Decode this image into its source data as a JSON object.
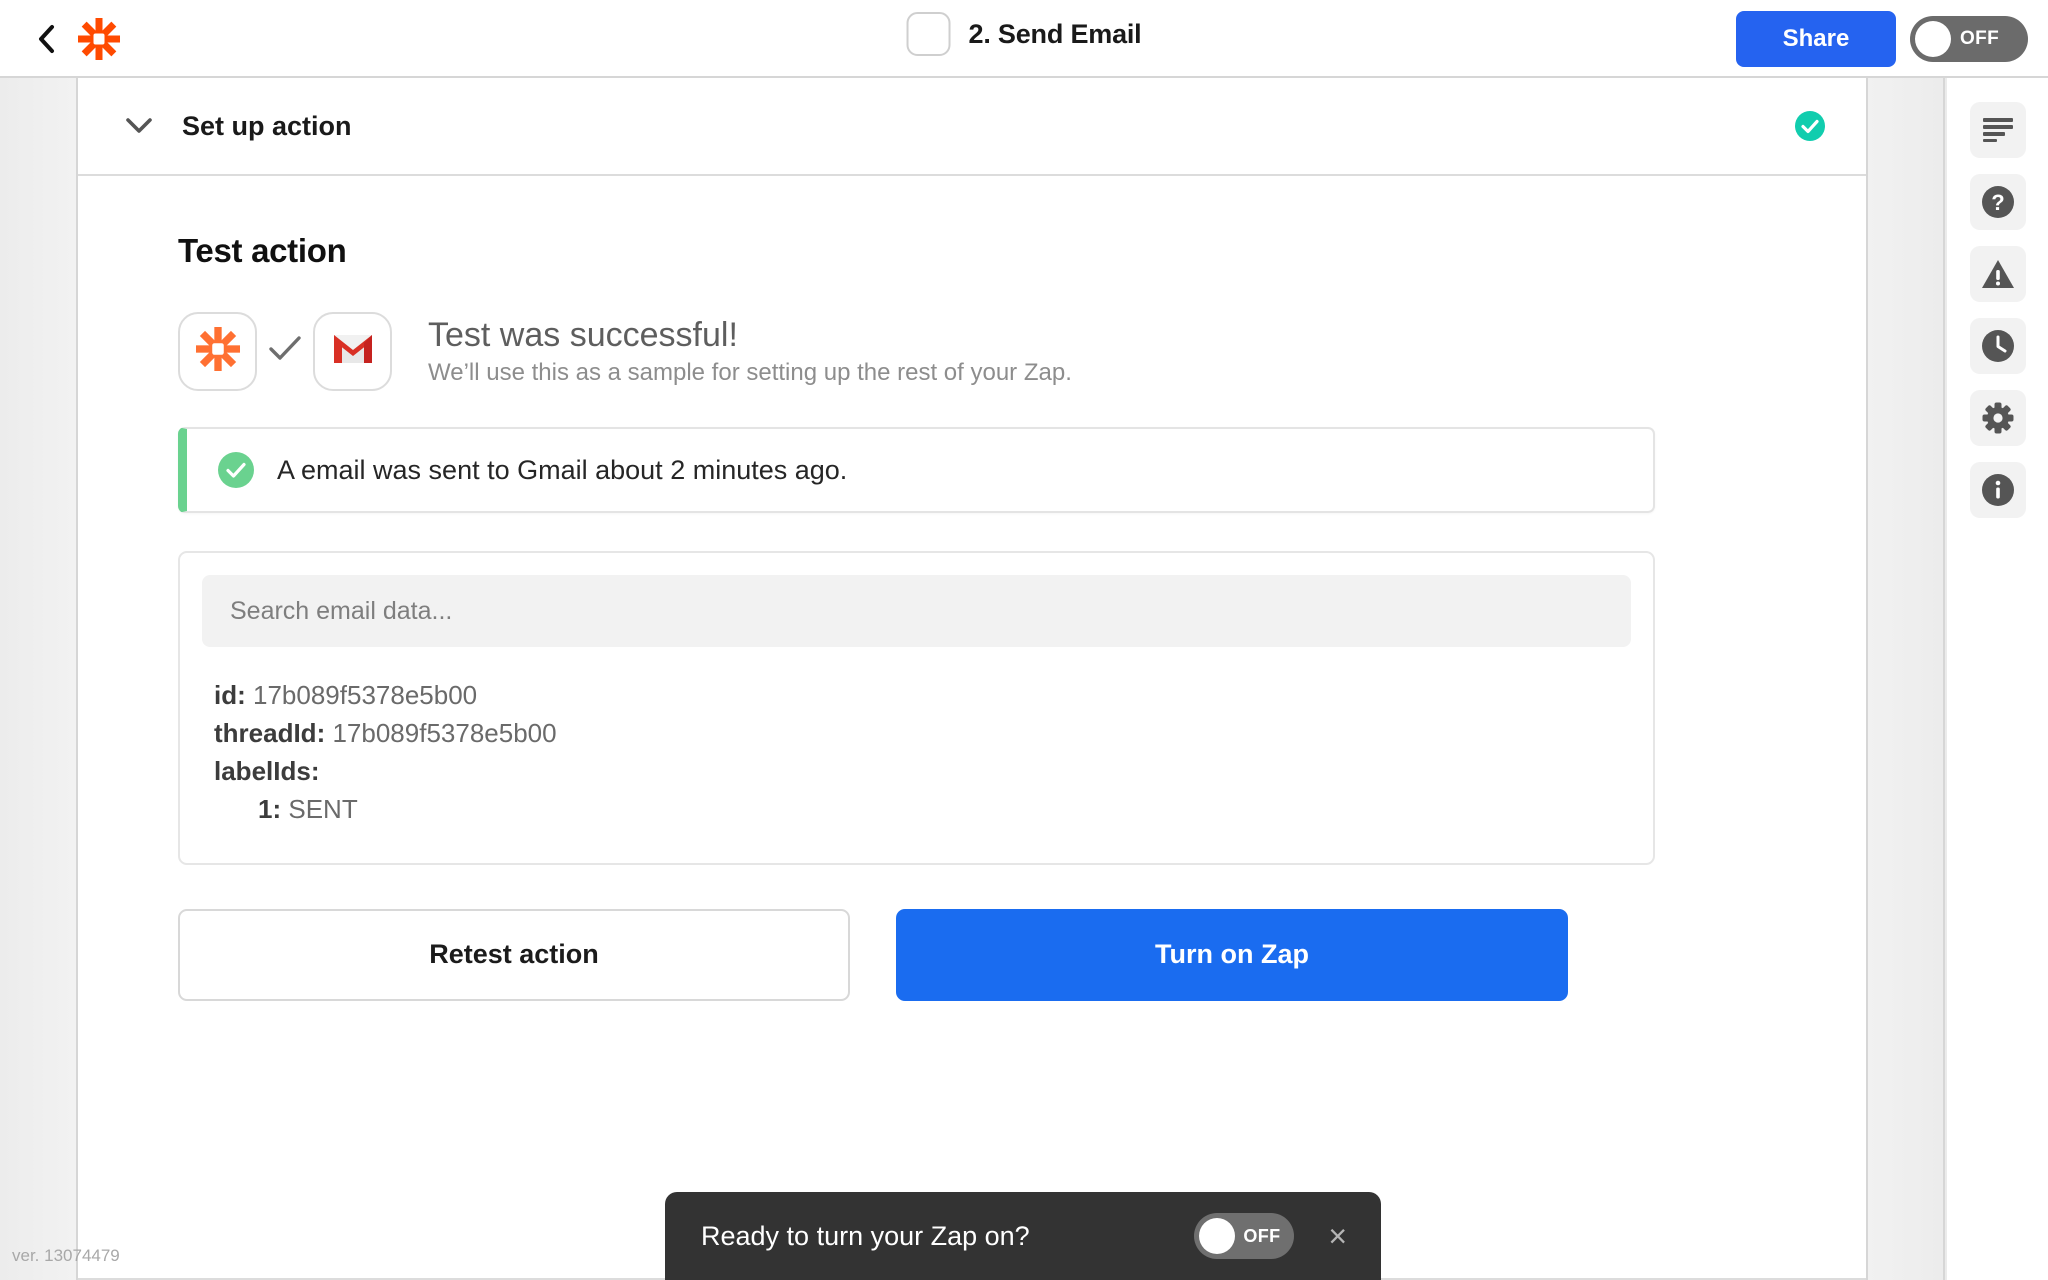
{
  "header": {
    "back_icon": "chevron-left-icon",
    "logo_icon": "zapier-logo-icon",
    "app_tile_icon": "app-placeholder-icon",
    "step_title": "2. Send Email",
    "share_label": "Share",
    "power_toggle": {
      "state_label": "OFF",
      "on": false
    }
  },
  "version_text": "ver. 13074479",
  "section": {
    "chevron_icon": "chevron-down-icon",
    "title": "Set up action",
    "status_icon": "check-circle-icon",
    "status_color": "#11cdae"
  },
  "test_action": {
    "heading": "Test action",
    "left_app_icon": "zapier-logo-icon",
    "connector_icon": "check-mark-icon",
    "right_app_icon": "gmail-icon",
    "result_title": "Test was successful!",
    "result_subtitle": "We’ll use this as a sample for setting up the rest of your Zap.",
    "banner": {
      "icon": "check-circle-icon",
      "text": "A email was sent to Gmail about 2 minutes ago.",
      "accent_color": "#6ad28f"
    },
    "data_card": {
      "search_placeholder": "Search email data...",
      "search_value": "",
      "fields": [
        {
          "key": "id:",
          "value": "17b089f5378e5b00",
          "indent": false
        },
        {
          "key": "threadId:",
          "value": "17b089f5378e5b00",
          "indent": false
        },
        {
          "key": "labelIds:",
          "value": "",
          "indent": false
        },
        {
          "key": "1:",
          "value": "SENT",
          "indent": true
        }
      ]
    },
    "retest_label": "Retest action",
    "turn_on_label": "Turn on Zap",
    "primary_color": "#1a6cf0"
  },
  "toast": {
    "text": "Ready to turn your Zap on?",
    "toggle_label": "OFF",
    "toggle_on": false,
    "close_icon": "close-icon"
  },
  "rail": {
    "items": [
      {
        "icon": "notes-lines-icon",
        "name": "rail-item-notes"
      },
      {
        "icon": "help-question-icon",
        "name": "rail-item-help"
      },
      {
        "icon": "warning-triangle-icon",
        "name": "rail-item-warnings"
      },
      {
        "icon": "clock-history-icon",
        "name": "rail-item-history"
      },
      {
        "icon": "gear-settings-icon",
        "name": "rail-item-settings"
      },
      {
        "icon": "info-circle-icon",
        "name": "rail-item-info"
      }
    ]
  }
}
